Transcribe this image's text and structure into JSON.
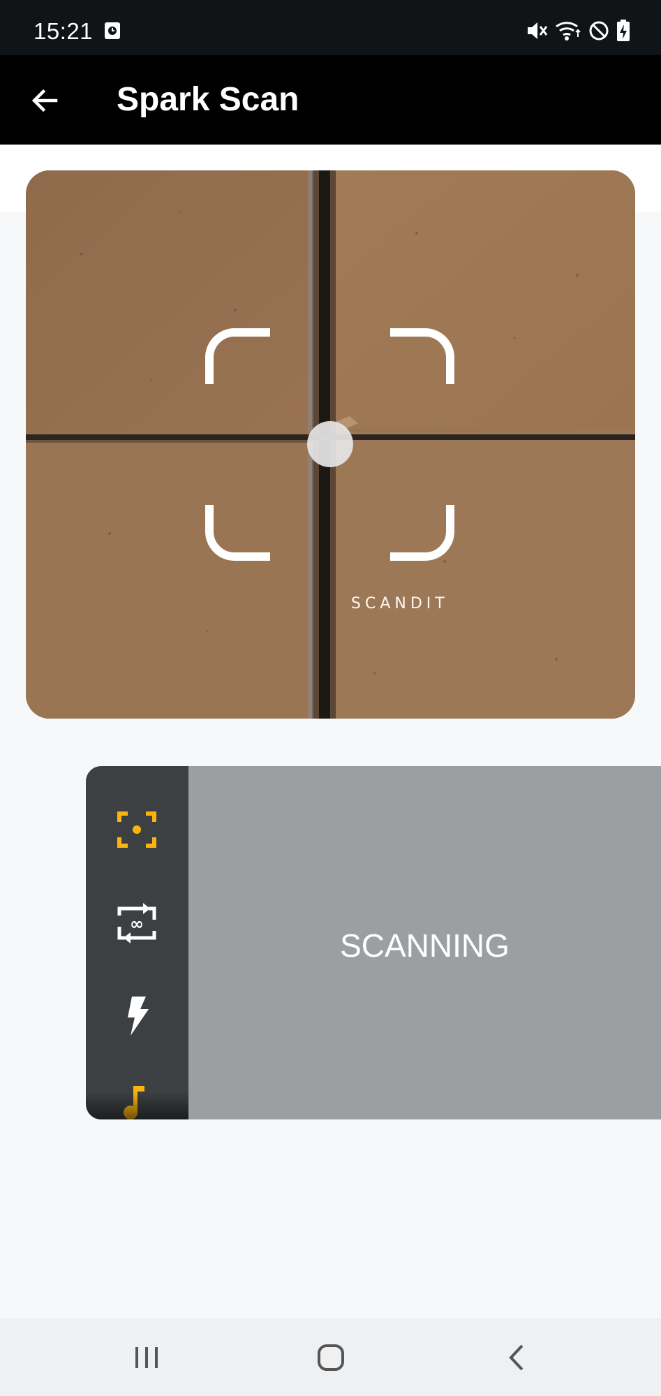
{
  "status_bar": {
    "time": "15:21",
    "icons": [
      "screen-recording-icon",
      "mute-icon",
      "wifi-icon",
      "do-not-disturb-icon",
      "battery-charging-icon"
    ]
  },
  "app_bar": {
    "title": "Spark Scan",
    "back_icon": "arrow-left-icon"
  },
  "camera": {
    "logo": "SCANDIT",
    "viewfinder": "corner-brackets"
  },
  "scan_widget": {
    "trigger_label": "SCANNING",
    "tools": [
      "target-mode-icon",
      "continuous-scan-icon",
      "flash-icon",
      "sound-icon"
    ],
    "accent_color": "#fbb40f",
    "toolbar_color": "#3c4043",
    "trigger_color": "#9c9fa2"
  },
  "nav_bar": {
    "buttons": [
      "recent-apps-icon",
      "home-icon",
      "back-icon"
    ]
  }
}
